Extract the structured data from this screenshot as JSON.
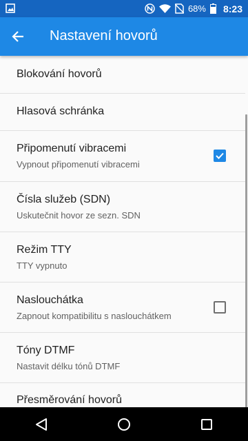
{
  "status_bar": {
    "battery_percent": "68%",
    "time": "8:23",
    "icons": [
      "gallery-notification-icon",
      "nfc-icon",
      "wifi-icon",
      "no-sim-icon",
      "battery-icon"
    ]
  },
  "toolbar": {
    "title": "Nastavení hovorů",
    "back_icon": "arrow-back-icon"
  },
  "settings": {
    "items": [
      {
        "title": "Blokování hovorů"
      },
      {
        "title": "Hlasová schránka"
      },
      {
        "title": "Připomenutí vibracemi",
        "summary": "Vypnout připomenutí vibracemi",
        "checked": true
      },
      {
        "title": "Čísla služeb (SDN)",
        "summary": "Uskutečnit hovor ze sezn. SDN"
      },
      {
        "title": "Režim TTY",
        "summary": "TTY vypnuto"
      },
      {
        "title": "Naslouchátka",
        "summary": "Zapnout kompatibilitu s naslouchátkem",
        "checked": false
      },
      {
        "title": "Tóny DTMF",
        "summary": "Nastavit délku tónů DTMF"
      },
      {
        "title": "Přesměrování hovorů"
      }
    ]
  },
  "nav_bar": {
    "icons": [
      "back-triangle-icon",
      "home-circle-icon",
      "recents-square-icon"
    ]
  },
  "colors": {
    "status_bar": "#1565c0",
    "toolbar": "#1e88e5",
    "accent": "#1e88e5"
  }
}
